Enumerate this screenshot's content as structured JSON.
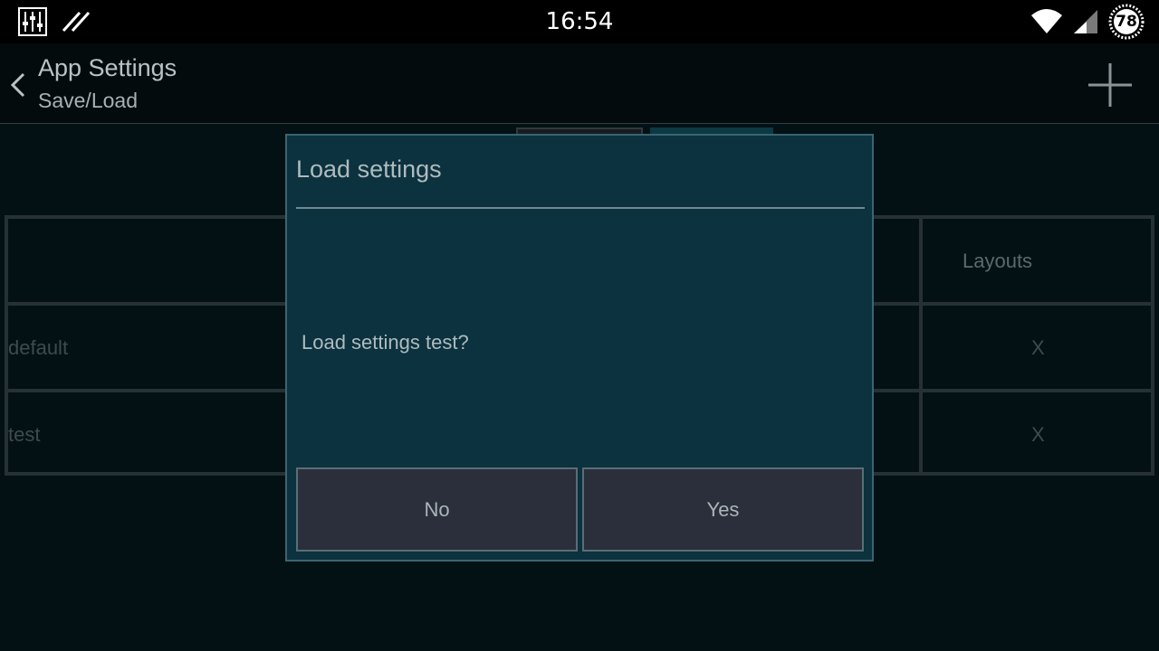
{
  "status_bar": {
    "time": "16:54",
    "battery_level": "78",
    "icons": [
      "equalizer-icon",
      "slash-icon",
      "wifi-icon",
      "signal-icon",
      "battery-icon"
    ]
  },
  "action_bar": {
    "title": "App Settings",
    "subtitle": "Save/Load",
    "back_icon": "chevron-left-icon",
    "add_icon": "plus-icon"
  },
  "table": {
    "header": [
      "",
      "Layouts"
    ],
    "rows": [
      {
        "name": "default",
        "action": "X"
      },
      {
        "name": "test",
        "action": "X"
      }
    ]
  },
  "dialog": {
    "title": "Load settings",
    "message": "Load settings test?",
    "no_label": "No",
    "yes_label": "Yes"
  },
  "colors": {
    "background": "#041418",
    "dialog_bg": "#0b323e",
    "button_bg": "#2b2f3b",
    "text": "#aebbbf"
  }
}
